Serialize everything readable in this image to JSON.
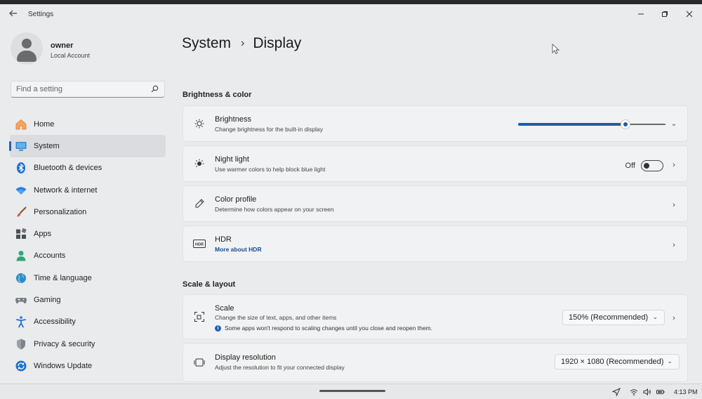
{
  "window": {
    "app_title": "Settings"
  },
  "user": {
    "name": "owner",
    "account_type": "Local Account"
  },
  "search": {
    "placeholder": "Find a setting"
  },
  "nav": {
    "items": [
      {
        "label": "Home",
        "icon": "home-icon"
      },
      {
        "label": "System",
        "icon": "monitor-icon",
        "active": true
      },
      {
        "label": "Bluetooth & devices",
        "icon": "bluetooth-icon"
      },
      {
        "label": "Network & internet",
        "icon": "wifi-icon"
      },
      {
        "label": "Personalization",
        "icon": "brush-icon"
      },
      {
        "label": "Apps",
        "icon": "apps-icon"
      },
      {
        "label": "Accounts",
        "icon": "person-icon"
      },
      {
        "label": "Time & language",
        "icon": "globe-icon"
      },
      {
        "label": "Gaming",
        "icon": "controller-icon"
      },
      {
        "label": "Accessibility",
        "icon": "accessibility-icon"
      },
      {
        "label": "Privacy & security",
        "icon": "shield-icon"
      },
      {
        "label": "Windows Update",
        "icon": "update-icon"
      }
    ]
  },
  "breadcrumb": {
    "parent": "System",
    "current": "Display"
  },
  "brightness_color": {
    "section_title": "Brightness & color",
    "brightness": {
      "title": "Brightness",
      "subtitle": "Change brightness for the built-in display",
      "value_fraction": 0.73
    },
    "night_light": {
      "title": "Night light",
      "subtitle": "Use warmer colors to help block blue light",
      "state_label": "Off",
      "enabled": false
    },
    "color_profile": {
      "title": "Color profile",
      "subtitle": "Determine how colors appear on your screen"
    },
    "hdr": {
      "title": "HDR",
      "link": "More about HDR",
      "badge": "HDR"
    }
  },
  "scale_layout": {
    "section_title": "Scale & layout",
    "scale": {
      "title": "Scale",
      "subtitle": "Change the size of text, apps, and other items",
      "info": "Some apps won't respond to scaling changes until you close and reopen them.",
      "info_glyph": "i",
      "selected": "150% (Recommended)"
    },
    "resolution": {
      "title": "Display resolution",
      "subtitle": "Adjust the resolution to fit your connected display",
      "selected": "1920 × 1080 (Recommended)"
    }
  },
  "taskbar": {
    "time": "4:13 PM"
  },
  "colors": {
    "accent": "#1d63b8",
    "background": "#e9ebed",
    "card": "#f1f2f3"
  }
}
